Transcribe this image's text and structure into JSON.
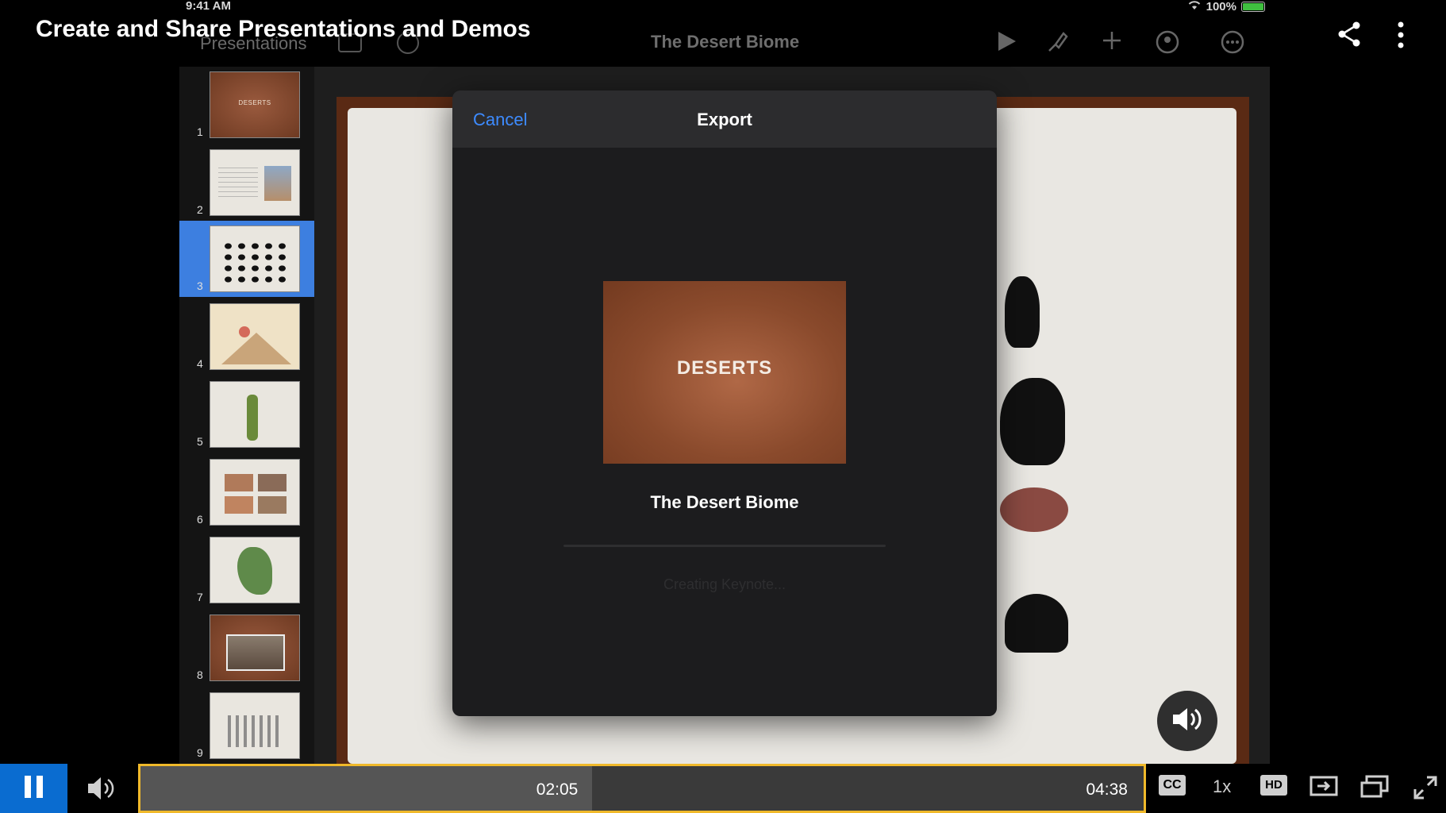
{
  "status_bar": {
    "time": "9:41 AM",
    "battery": "100%"
  },
  "keynote": {
    "presentations_label": "Presentations",
    "document_title": "The Desert Biome",
    "slides": [
      {
        "number": "1",
        "title": "DESERTS"
      },
      {
        "number": "2"
      },
      {
        "number": "3"
      },
      {
        "number": "4"
      },
      {
        "number": "5"
      },
      {
        "number": "6"
      },
      {
        "number": "7"
      },
      {
        "number": "8"
      },
      {
        "number": "9"
      }
    ],
    "selected_slide": 3
  },
  "export_dialog": {
    "cancel_label": "Cancel",
    "title": "Export",
    "preview_title": "DESERTS",
    "document_name": "The Desert Biome",
    "status": "Creating Keynote..."
  },
  "overlay": {
    "video_title": "Create and Share Presentations and Demos"
  },
  "player": {
    "current_time": "02:05",
    "duration": "04:38",
    "progress_fraction": 0.45,
    "cc_label": "CC",
    "speed_label": "1x",
    "hd_label": "HD",
    "colors": {
      "play_button": "#0a6cd0",
      "scrub_border": "#f0b92a"
    }
  }
}
